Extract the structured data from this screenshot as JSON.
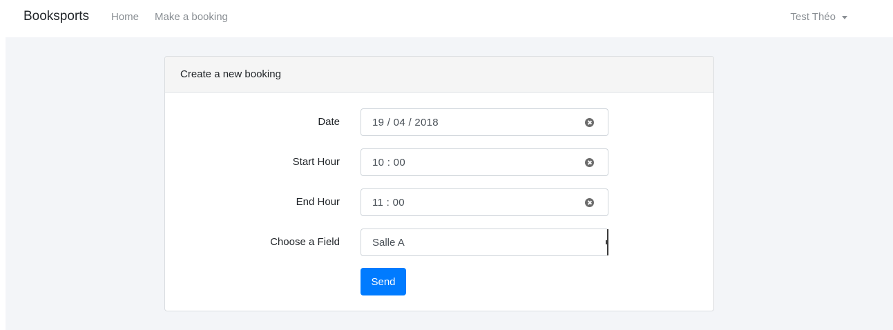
{
  "navbar": {
    "brand": "Booksports",
    "links": [
      "Home",
      "Make a booking"
    ],
    "user": "Test Théo"
  },
  "card": {
    "title": "Create a new booking",
    "fields": [
      {
        "label": "Date",
        "value": "19 / 04 / 2018",
        "icon": "clear-icon"
      },
      {
        "label": "Start Hour",
        "value": "10 : 00",
        "icon": "clear-icon"
      },
      {
        "label": "End Hour",
        "value": "11 : 00",
        "icon": "clear-icon"
      }
    ],
    "field_select": {
      "label": "Choose a Field",
      "value": "Salle A"
    },
    "submit_label": "Send"
  },
  "colors": {
    "primary": "#007bff",
    "background": "#f3f5f8",
    "muted_text": "#8a8f94"
  }
}
